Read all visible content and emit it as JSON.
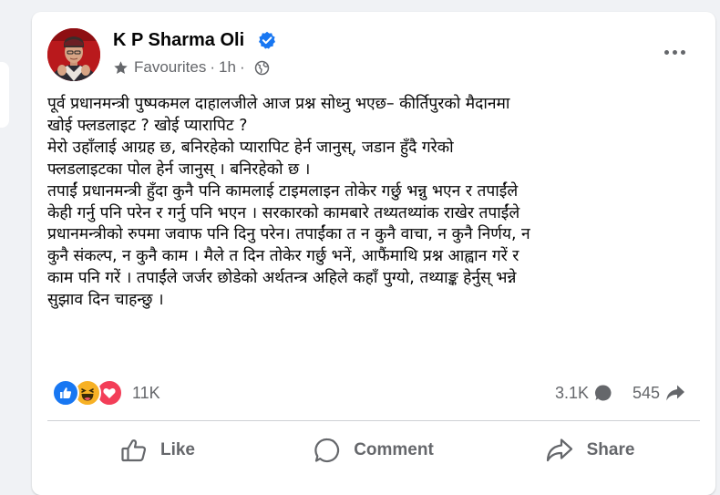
{
  "post": {
    "author": "K P Sharma Oli",
    "audience": "Favourites",
    "dot": "·",
    "time": "1h",
    "lines": [
      "पूर्व प्रधानमन्त्री पुष्पकमल दाहालजीले आज प्रश्न सोध्नु भएछ– कीर्तिपुरको मैदानमा",
      "खोई फ्लडलाइट ? खोई प्यारापिट ?",
      "मेरो उहाँलाई आग्रह छ, बनिरहेको प्यारापिट हेर्न जानुस्, जडान हुँदै गरेको",
      "फ्लडलाइटका पोल हेर्न जानुस् । बनिरहेको छ ।",
      "तपाईं प्रधानमन्त्री हुँदा कुनै पनि कामलाई टाइमलाइन तोकेर गर्छु भन्नु भएन र तपाईंले",
      "केही गर्नु पनि परेन र गर्नु पनि भएन । सरकारको कामबारे तथ्यतथ्यांक राखेर तपाईंले",
      "प्रधानमन्त्रीको रुपमा जवाफ पनि दिनु परेन। तपाईंका त न कुनै वाचा, न कुनै निर्णय, न",
      "कुनै संकल्प, न कुनै काम । मैले त दिन तोकेर गर्छु भनें, आफैंमाथि प्रश्न आह्वान गरें र",
      "काम पनि गरें । तपाईंले जर्जर छोडेको अर्थतन्त्र अहिले कहाँ पुग्यो, तथ्याङ्क हेर्नुस् भन्ने",
      "सुझाव दिन चाहन्छु ।"
    ]
  },
  "stats": {
    "reactions": "11K",
    "comments": "3.1K",
    "shares": "545"
  },
  "actions": {
    "like": "Like",
    "comment": "Comment",
    "share": "Share"
  },
  "colors": {
    "card_bg": "#ffffff",
    "page_bg": "#f0f2f5",
    "text_primary": "#050505",
    "text_secondary": "#65676b",
    "verified_blue": "#1877f2",
    "like_blue": "#1877f2",
    "haha_yellow": "#f7b125",
    "love_red": "#f33e58"
  },
  "icons": {
    "verified": "verified-badge-icon",
    "favourites": "star-icon",
    "audience": "globe-icon",
    "more": "more-options-icon",
    "comment_count": "comment-bubble-icon",
    "share_count": "share-arrow-icon",
    "like_action": "thumbs-up-icon",
    "comment_action": "comment-icon",
    "share_action": "share-icon"
  }
}
